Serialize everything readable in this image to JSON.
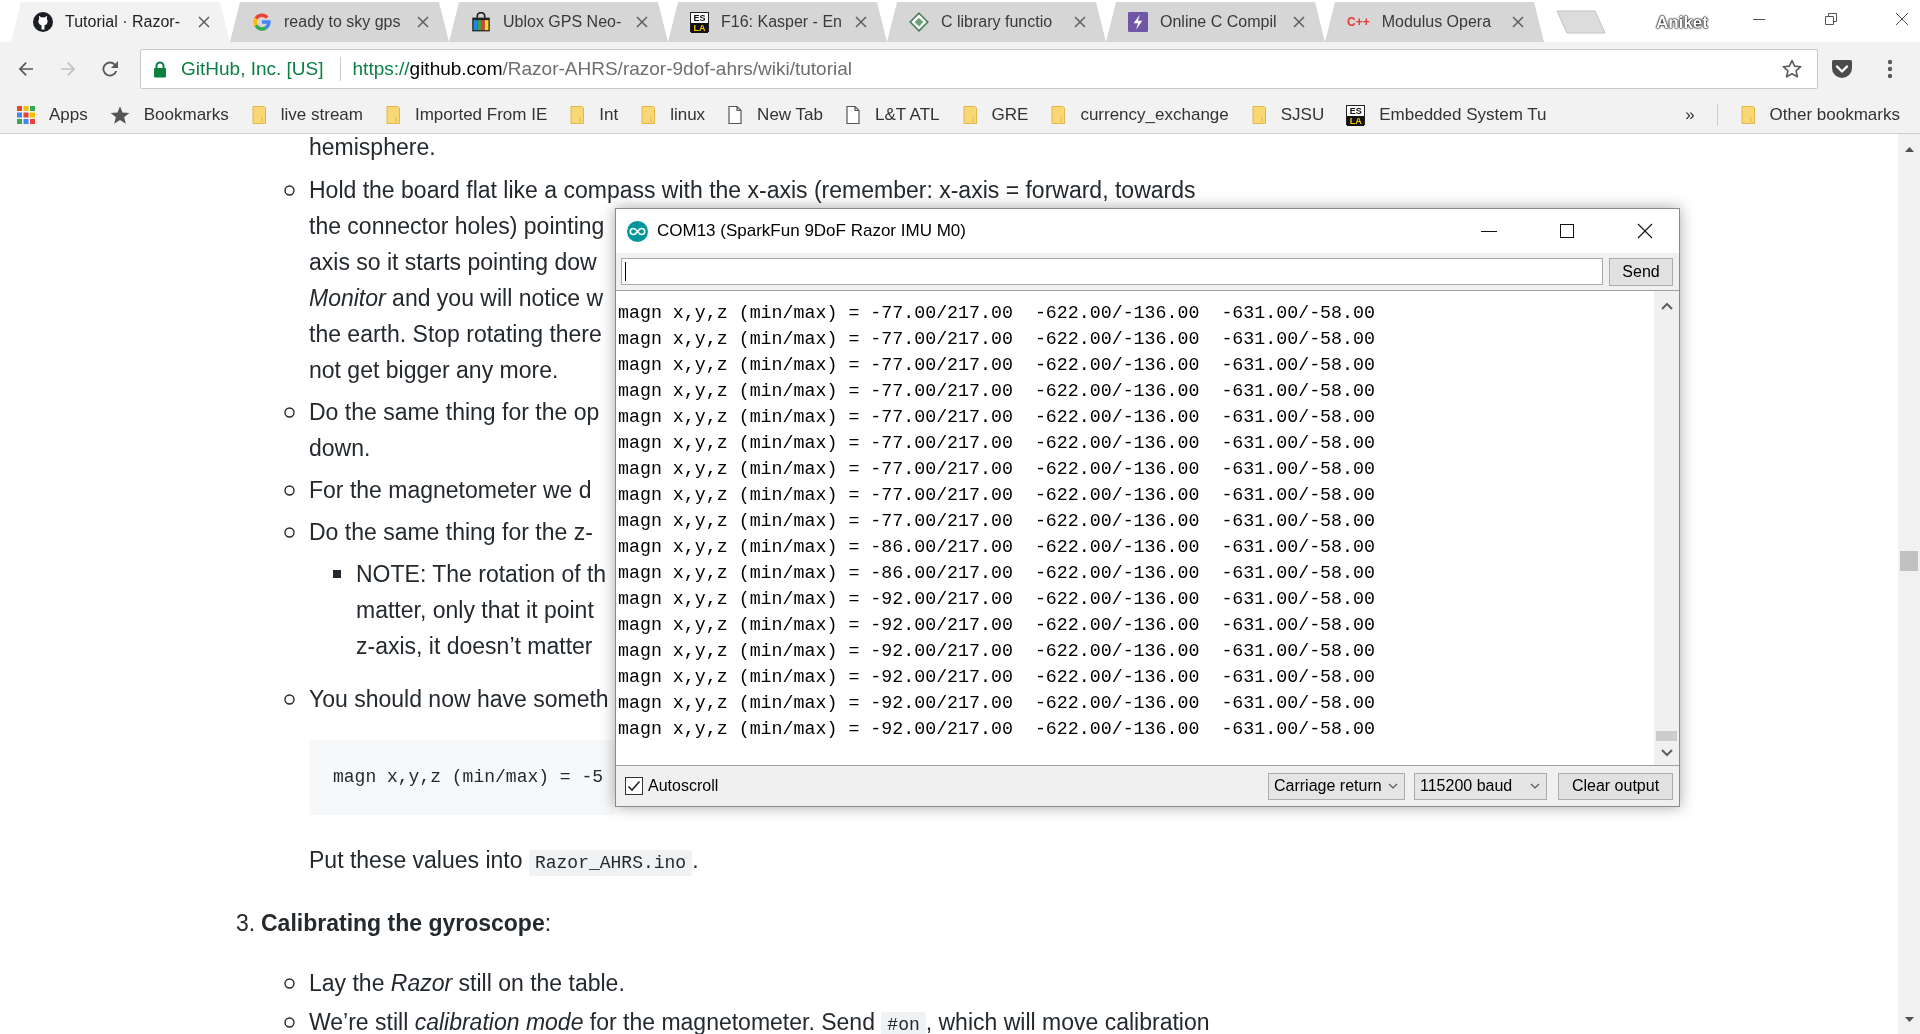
{
  "browser": {
    "tabs": [
      {
        "title": "Tutorial · Razor-",
        "kind": "cat",
        "selected": true
      },
      {
        "title": "ready to sky gps",
        "kind": "ring",
        "selected": false
      },
      {
        "title": "Ublox GPS Neo-",
        "kind": "bag",
        "selected": false
      },
      {
        "title": "F16: Kasper - En",
        "kind": "tile",
        "favicon_text": [
          "ES",
          "LA"
        ],
        "selected": false
      },
      {
        "title": "C library functio",
        "kind": "diamond",
        "selected": false
      },
      {
        "title": "Online C Compil",
        "kind": "bolt",
        "selected": false
      },
      {
        "title": "Modulus Opera",
        "kind": "text",
        "favicon_text": [
          "C++"
        ],
        "selected": false
      }
    ],
    "profile": "Aniket",
    "navigation": [
      {
        "kind": "back",
        "disabled": false
      },
      {
        "kind": "forward",
        "disabled": true
      },
      {
        "kind": "reload",
        "disabled": false
      }
    ],
    "address": {
      "site_identity": "GitHub, Inc. [US]",
      "url_scheme": "https://",
      "url_host": "github.com",
      "url_path": "/Razor-AHRS/razor-9dof-ahrs/wiki/tutorial"
    },
    "bookmarks": [
      {
        "label": "Apps",
        "kind": "apps"
      },
      {
        "label": "Bookmarks",
        "kind": "star"
      },
      {
        "label": "live stream",
        "kind": "folder"
      },
      {
        "label": "Imported From IE",
        "kind": "folder"
      },
      {
        "label": "Int",
        "kind": "folder"
      },
      {
        "label": "linux",
        "kind": "folder"
      },
      {
        "label": "New Tab",
        "kind": "page"
      },
      {
        "label": "L&T ATL",
        "kind": "page"
      },
      {
        "label": "GRE",
        "kind": "folder"
      },
      {
        "label": "currency_exchange",
        "kind": "folder"
      },
      {
        "label": "SJSU",
        "kind": "folder"
      },
      {
        "label": "Embedded System Tu",
        "kind": "tile",
        "icon_text": [
          "ES",
          "LA"
        ]
      }
    ],
    "overflow_label": "»",
    "other_bookmarks": {
      "label": "Other bookmarks",
      "kind": "folder"
    }
  },
  "article": {
    "items": [
      {
        "kind": "continuation",
        "lines": [
          "hemisphere."
        ]
      },
      {
        "kind": "bullet",
        "lines": [
          "Hold the board flat like a compass with the x-axis (remember: x-axis = forward, towards",
          "the connector holes) pointing",
          "axis so it starts pointing dow",
          "*Monitor* and you will notice w",
          "the earth. Stop rotating there",
          "not get bigger any more."
        ]
      },
      {
        "kind": "bullet",
        "lines": [
          "Do the same thing for the op",
          "down."
        ]
      },
      {
        "kind": "bullet",
        "lines": [
          "For the magnetometer we d"
        ]
      },
      {
        "kind": "bullet",
        "lines": [
          "Do the same thing for the z-"
        ],
        "children": [
          {
            "kind": "square",
            "lines": [
              "NOTE: The rotation of th",
              "matter, only that it point",
              "z-axis, it doesn’t matter"
            ]
          }
        ]
      },
      {
        "kind": "bullet",
        "lines": [
          "You should now have someth"
        ]
      },
      {
        "kind": "code",
        "lines": [
          "magn x,y,z (min/max) = -5"
        ]
      },
      {
        "kind": "paragraph",
        "lines": [
          [
            {
              "kind": "text",
              "text": "Put these values into "
            },
            {
              "kind": "code",
              "text": "Razor_AHRS.ino"
            },
            {
              "kind": "text",
              "text": "."
            }
          ]
        ]
      },
      {
        "kind": "numbered",
        "number": "3.",
        "lines": [
          "**Calibrating the gyroscope**:"
        ],
        "children": [
          {
            "kind": "bullet",
            "lines": [
              "Lay the *Razor* still on the table."
            ]
          },
          {
            "kind": "bullet",
            "lines": [
              [
                {
                  "kind": "text",
                  "text": "We’re still *calibration mode* for the magnetometer. Send "
                },
                {
                  "kind": "code",
                  "text": "#on"
                },
                {
                  "kind": "text",
                  "text": ", which will move calibration"
                }
              ]
            ]
          }
        ]
      }
    ]
  },
  "serial_monitor": {
    "title": "COM13 (SparkFun 9DoF Razor IMU M0)",
    "send_button": "Send",
    "output_lines": [
      "magn x,y,z (min/max) = -77.00/217.00  -622.00/-136.00  -631.00/-58.00",
      "magn x,y,z (min/max) = -77.00/217.00  -622.00/-136.00  -631.00/-58.00",
      "magn x,y,z (min/max) = -77.00/217.00  -622.00/-136.00  -631.00/-58.00",
      "magn x,y,z (min/max) = -77.00/217.00  -622.00/-136.00  -631.00/-58.00",
      "magn x,y,z (min/max) = -77.00/217.00  -622.00/-136.00  -631.00/-58.00",
      "magn x,y,z (min/max) = -77.00/217.00  -622.00/-136.00  -631.00/-58.00",
      "magn x,y,z (min/max) = -77.00/217.00  -622.00/-136.00  -631.00/-58.00",
      "magn x,y,z (min/max) = -77.00/217.00  -622.00/-136.00  -631.00/-58.00",
      "magn x,y,z (min/max) = -77.00/217.00  -622.00/-136.00  -631.00/-58.00",
      "magn x,y,z (min/max) = -86.00/217.00  -622.00/-136.00  -631.00/-58.00",
      "magn x,y,z (min/max) = -86.00/217.00  -622.00/-136.00  -631.00/-58.00",
      "magn x,y,z (min/max) = -92.00/217.00  -622.00/-136.00  -631.00/-58.00",
      "magn x,y,z (min/max) = -92.00/217.00  -622.00/-136.00  -631.00/-58.00",
      "magn x,y,z (min/max) = -92.00/217.00  -622.00/-136.00  -631.00/-58.00",
      "magn x,y,z (min/max) = -92.00/217.00  -622.00/-136.00  -631.00/-58.00",
      "magn x,y,z (min/max) = -92.00/217.00  -622.00/-136.00  -631.00/-58.00",
      "magn x,y,z (min/max) = -92.00/217.00  -622.00/-136.00  -631.00/-58.00"
    ],
    "autoscroll": {
      "label": "Autoscroll",
      "checked": true
    },
    "line_ending": "Carriage return",
    "baud_rate": "115200 baud",
    "clear_button": "Clear output"
  }
}
